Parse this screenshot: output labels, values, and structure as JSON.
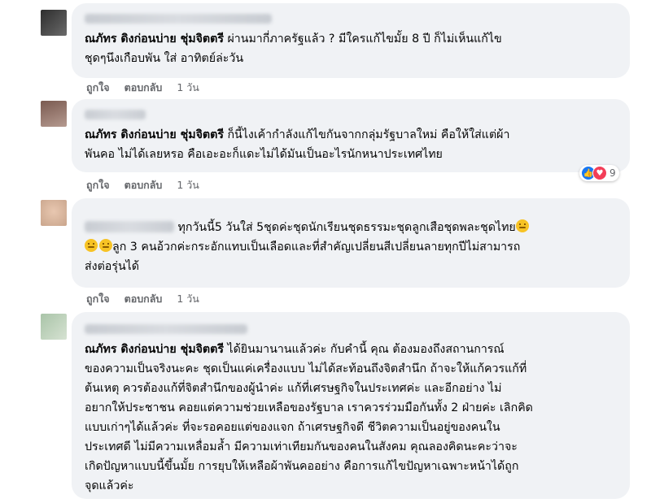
{
  "comments": [
    {
      "author": "ณภัทร ดิงก่อนบ่าย ชุ่มจิตตรี",
      "text": " ผ่านมากี่ภาครัฐแล้ว ? มีใครแก้ไขมั้ย 8 ปี ก็ไม่เห็นแก้ไข",
      "text2": "ชุดๆนึงเกือบพัน ใส่ อาทิตย์ล่ะวัน",
      "like": "ถูกใจ",
      "reply": "ตอบกลับ",
      "time": "1 วัน"
    },
    {
      "author": "ณภัทร ดิงก่อนบ่าย ชุ่มจิตตรี",
      "text": " ก็นี้ไงเค้ากำลังแก้ไขกันจากกลุ่มรัฐบาลใหม่ คือให้ใส่แต่ผ้า",
      "text2": "พันคอ ไม่ได้เลยหรอ คือเอะอะก็แดะไม่ได้มันเป็นอะไรนักหนาประเทศไทย",
      "like": "ถูกใจ",
      "reply": "ตอบกลับ",
      "time": "1 วัน",
      "reaction_count": "9"
    },
    {
      "text": " ทุกวันนี้5 วันใส่ 5ชุดค่ะชุดนักเรียนชุดธรรมะชุดลูกเสือชุดพละชุดไทย",
      "text2": "ลูก 3 คนอ้วกค่ะกระอักแทบเป็นเลือดและที่สำคัญเปลี่ยนสีเปลี่ยนลายทุกปีไม่สามารถ",
      "text3": "ส่งต่อรุ่นได้",
      "like": "ถูกใจ",
      "reply": "ตอบกลับ",
      "time": "1 วัน"
    },
    {
      "author": "ณภัทร ดิงก่อนบ่าย ชุ่มจิตตรี",
      "lines": [
        " ได้ยินมานานแล้วค่ะ กับคำนี้ คุณ ต้องมองถึงสถานการณ์",
        "ของความเป็นจริงนะคะ ชุดเป็นแค่เครื่องแบบ ไม่ได้สะท้อนถึงจิตสำนึก ถ้าจะให้แก้ควรแก้ที่",
        "ต้นเหตุ ควรต้องแก้ที่จิตสำนึกของผู้นำค่ะ แก้ที่เศรษฐกิจในประเทศค่ะ และอีกอย่าง ไม่",
        "อยากให้ประชาชน คอยแต่ความช่วยเหลือของรัฐบาล เราควรร่วมมือกันทั้ง 2 ฝ่ายค่ะ เลิกคิด",
        "แบบเก่าๆได้แล้วค่ะ ที่จะรอคอยแต่ของแจก ถ้าเศรษฐกิจดี ชีวิตความเป็นอยู่ของคนใน",
        "ประเทศดี ไม่มีความเหลื่อมล้ำ มีความเท่าเทียมกันของคนในสังคม คุณลองคิดนะคะว่าจะ",
        "เกิดปัญหาแบบนี้ขึ้นมั้ย การยุบให้เหลือผ้าพันคออย่าง คือการแก้ไขปัญหาเฉพาะหน้าได้ถูก",
        "จุดแล้วค่ะ"
      ]
    }
  ],
  "colors": {
    "bubble": "#f0f2f5",
    "meta": "#65676b",
    "like": "#1877f2",
    "love": "#f33e58"
  },
  "icons": {
    "like": "thumbs-up-icon",
    "love": "heart-icon",
    "emoji": "sad-face-emoji-icon"
  }
}
